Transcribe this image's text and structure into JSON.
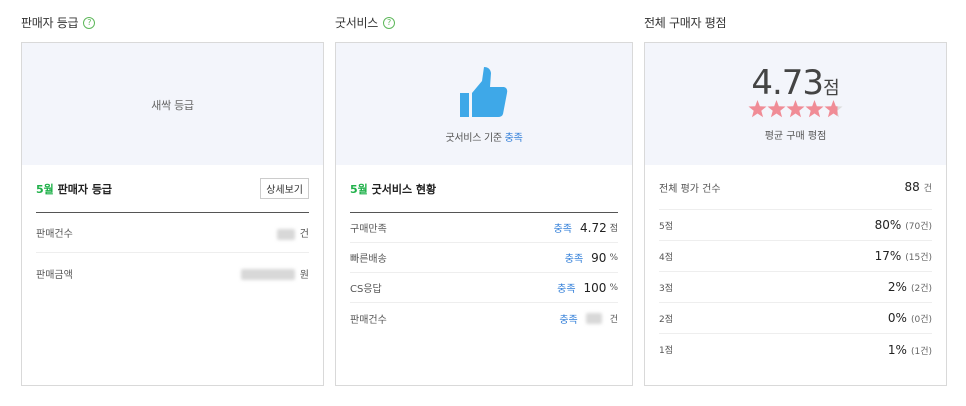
{
  "seller_grade": {
    "title": "판매자 등급",
    "help": "?",
    "grade_label": "새싹 등급",
    "month": "5월",
    "sub_title": "판매자 등급",
    "detail_button": "상세보기",
    "rows": [
      {
        "label": "판매건수",
        "unit": "건"
      },
      {
        "label": "판매금액",
        "unit": "원"
      }
    ]
  },
  "good_service": {
    "title": "굿서비스",
    "help": "?",
    "caption_prefix": "굿서비스 기준",
    "caption_status": "충족",
    "month": "5월",
    "sub_title": "굿서비스 현황",
    "rows": [
      {
        "label": "구매만족",
        "status": "충족",
        "value": "4.72",
        "unit": "점"
      },
      {
        "label": "빠른배송",
        "status": "충족",
        "value": "90",
        "unit": "%"
      },
      {
        "label": "CS응답",
        "status": "충족",
        "value": "100",
        "unit": "%"
      },
      {
        "label": "판매건수",
        "status": "충족",
        "value": "",
        "unit": "건"
      }
    ],
    "accent_color": "#3ea8e8"
  },
  "rating": {
    "title": "전체 구매자 평점",
    "score": "4.73",
    "score_unit": "점",
    "star_value": 4.73,
    "star_color": "#f08c96",
    "avg_label": "평균 구매 평점",
    "total_label": "전체 평가 건수",
    "total_value": "88",
    "total_unit": "건",
    "rows": [
      {
        "label": "5점",
        "pct": "80%",
        "count": "(70건)"
      },
      {
        "label": "4점",
        "pct": "17%",
        "count": "(15건)"
      },
      {
        "label": "3점",
        "pct": "2%",
        "count": "(2건)"
      },
      {
        "label": "2점",
        "pct": "0%",
        "count": "(0건)"
      },
      {
        "label": "1점",
        "pct": "1%",
        "count": "(1건)"
      }
    ]
  }
}
